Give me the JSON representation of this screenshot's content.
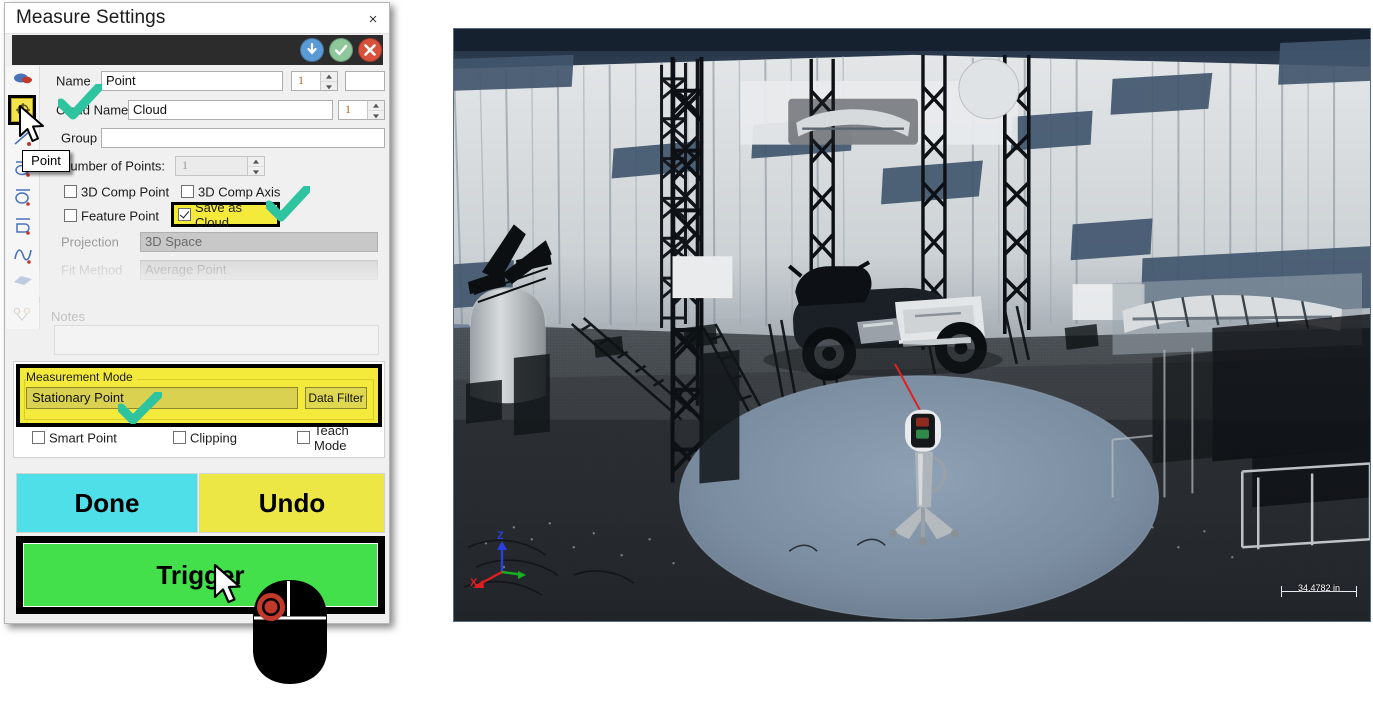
{
  "dialog": {
    "title": "Measure Settings",
    "close_label": "×",
    "action_bar": {
      "buttons": [
        {
          "name": "download-button",
          "icon": "arrow-down-circle-icon",
          "color": "#5a9bd5"
        },
        {
          "name": "accept-button",
          "icon": "check-circle-icon",
          "color": "#8ec79a"
        },
        {
          "name": "cancel-button",
          "icon": "x-circle-icon",
          "color": "#d9503c"
        }
      ]
    },
    "tool_rail": {
      "tooltip": "Point",
      "selected_tool": "point-tool",
      "items": [
        {
          "name": "cloud-tool",
          "icon": "cloud-icon"
        },
        {
          "name": "point-tool",
          "icon": "point-crosshair-icon"
        },
        {
          "name": "line-tool",
          "icon": "line-icon"
        },
        {
          "name": "circle-tool",
          "icon": "circle-icon"
        },
        {
          "name": "arc-tool",
          "icon": "arc-icon"
        },
        {
          "name": "slot-tool",
          "icon": "slot-icon"
        },
        {
          "name": "spline-tool",
          "icon": "spline-icon"
        },
        {
          "name": "plane-tool",
          "icon": "plane-icon"
        },
        {
          "name": "alignment-tool",
          "icon": "alignment-icon"
        }
      ]
    },
    "fields": {
      "name_label": "Name",
      "name_value": "Point",
      "name_index": "1",
      "name_extra": "",
      "cloud_name_label": "Cloud Name",
      "cloud_name_value": "Cloud",
      "cloud_index": "1",
      "group_label": "Group",
      "group_value": "",
      "number_of_points_label": "Number of Points:",
      "number_of_points_value": "1",
      "projection_label": "Projection",
      "projection_value": "3D Space",
      "fit_method_label": "Fit Method",
      "fit_method_value": "Average Point"
    },
    "checkboxes": [
      {
        "name": "checkbox-3d-comp-point",
        "label": "3D Comp Point",
        "checked": false,
        "highlighted": false
      },
      {
        "name": "checkbox-3d-comp-axis",
        "label": "3D Comp Axis",
        "checked": false,
        "highlighted": false
      },
      {
        "name": "checkbox-feature-point",
        "label": "Feature Point",
        "checked": false,
        "highlighted": false
      },
      {
        "name": "checkbox-save-as-cloud",
        "label": "Save as Cloud",
        "checked": true,
        "highlighted": true
      }
    ],
    "notes": {
      "label": "Notes",
      "value": ""
    },
    "measurement_mode": {
      "group_label": "Measurement Mode",
      "mode_value": "Stationary Point",
      "data_filter_label": "Data Filter",
      "options": [
        {
          "name": "checkbox-smart-point",
          "label": "Smart Point",
          "checked": false
        },
        {
          "name": "checkbox-clipping",
          "label": "Clipping",
          "checked": false
        },
        {
          "name": "checkbox-teach-mode",
          "label": "Teach Mode",
          "checked": false
        }
      ]
    },
    "buttons": {
      "done": "Done",
      "undo": "Undo",
      "trigger": "Trigger"
    }
  },
  "viewport": {
    "scene_description": "3D point cloud scan of a studio / trade-show hall with white curtains, black truss towers, a motorcycle and a laser scanner on a tripod",
    "scale_bar_text": "34.4782 in",
    "axis_labels": {
      "x": "X",
      "y": "Y",
      "z": "Z"
    }
  },
  "annotations": {
    "check_marks": 3,
    "mouse_graphic": "left-click-mouse-icon",
    "cursors": 2
  },
  "colors": {
    "highlight_yellow": "#f4ea3c",
    "check_green": "#2ec4a0",
    "done_cyan": "#4fdfe8",
    "undo_yellow": "#ece745",
    "trigger_green": "#44e04b",
    "accent_blue": "#5a9bd5",
    "accent_red": "#d9503c"
  }
}
